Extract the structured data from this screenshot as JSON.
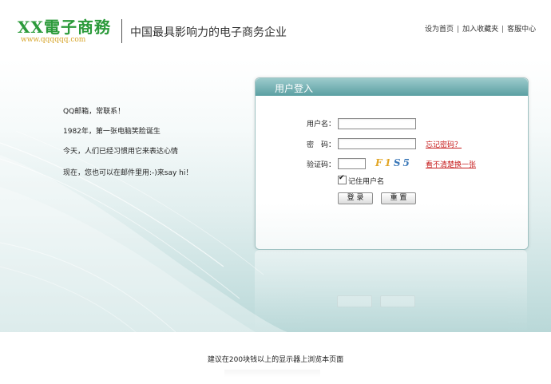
{
  "header": {
    "logo_title": "XX電子商務",
    "logo_url": "www.qqqqqq.com",
    "tagline": "中国最具影响力的电子商务企业",
    "links": [
      "设为首页",
      "加入收藏夹",
      "客服中心"
    ]
  },
  "intro_lines": [
    "QQ邮箱，常联系！",
    "1982年，第一张电脑笑脸诞生",
    "今天，人们已经习惯用它来表达心情",
    "现在，您也可以在邮件里用:-)来say hi！"
  ],
  "login": {
    "title": "用户登入",
    "username_label": "用户名：",
    "username_value": "",
    "password_label": "密　码：",
    "password_value": "",
    "forgot_password": "忘记密码？",
    "captcha_label": "验证码：",
    "captcha_value": "",
    "captcha_text_1": "F1",
    "captcha_text_2": "S5",
    "refresh_captcha": "看不清楚换一张",
    "remember_label": "记住用户名",
    "remember_checked": true,
    "login_button": "登 录",
    "reset_button": "重 置"
  },
  "footer": {
    "note": "建议在200块钱以上的显示器上浏览本页面"
  },
  "colors": {
    "brand_green": "#2b9a3a",
    "teal_header": "#5a9fa2",
    "link_red": "#c61b1b"
  }
}
